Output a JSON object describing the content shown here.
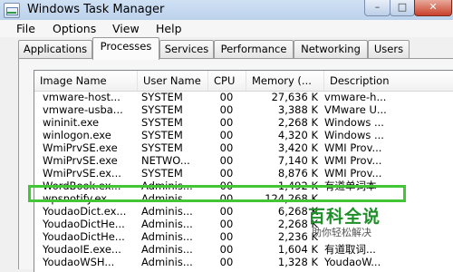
{
  "window": {
    "title": "Windows Task Manager",
    "controls": {
      "minimize": "–",
      "maximize": "□",
      "close": "✕"
    }
  },
  "menu": [
    "File",
    "Options",
    "View",
    "Help"
  ],
  "tabs": [
    "Applications",
    "Processes",
    "Services",
    "Performance",
    "Networking",
    "Users"
  ],
  "active_tab": "Processes",
  "columns": [
    "Image Name",
    "User Name",
    "CPU",
    "Memory (...",
    "Description"
  ],
  "rows": [
    {
      "name": "vmware-host...",
      "user": "SYSTEM",
      "cpu": "00",
      "mem": "27,636 K",
      "desc": "vmware-h..."
    },
    {
      "name": "vmware-usba...",
      "user": "SYSTEM",
      "cpu": "00",
      "mem": "3,388 K",
      "desc": "VMware U..."
    },
    {
      "name": "wininit.exe",
      "user": "SYSTEM",
      "cpu": "00",
      "mem": "2,268 K",
      "desc": "Windows ..."
    },
    {
      "name": "winlogon.exe",
      "user": "SYSTEM",
      "cpu": "00",
      "mem": "4,320 K",
      "desc": "Windows ..."
    },
    {
      "name": "WmiPrvSE.exe",
      "user": "SYSTEM",
      "cpu": "00",
      "mem": "3,420 K",
      "desc": "WMI Prov..."
    },
    {
      "name": "WmiPrvSE.exe",
      "user": "NETWO...",
      "cpu": "00",
      "mem": "7,140 K",
      "desc": "WMI Prov..."
    },
    {
      "name": "WmiPrvSE.ex...",
      "user": "SYSTEM",
      "cpu": "00",
      "mem": "8,876 K",
      "desc": "WMI Prov..."
    },
    {
      "name": "WordBook.ex...",
      "user": "Adminis...",
      "cpu": "00",
      "mem": "1,492 K",
      "desc": "有道单词本"
    },
    {
      "name": "wpsnotify.ex...",
      "user": "Adminis...",
      "cpu": "00",
      "mem": "124,268 K",
      "desc": ""
    },
    {
      "name": "YoudaoDict.ex...",
      "user": "Adminis...",
      "cpu": "00",
      "mem": "6,268 K",
      "desc": ""
    },
    {
      "name": "YoudaoDictHe...",
      "user": "Adminis...",
      "cpu": "00",
      "mem": "2,268 K",
      "desc": ""
    },
    {
      "name": "YoudaoDictHe...",
      "user": "Adminis...",
      "cpu": "00",
      "mem": "2,236 K",
      "desc": ""
    },
    {
      "name": "YoudaoIE.exe...",
      "user": "Adminis...",
      "cpu": "00",
      "mem": "1,604 K",
      "desc": "有道取词..."
    },
    {
      "name": "YoudaoWSH...",
      "user": "Adminis...",
      "cpu": "00",
      "mem": "1,328 K",
      "desc": "YoudaoW..."
    }
  ],
  "watermark": {
    "title": "百科全说",
    "subtitle": "助你轻松解决"
  }
}
